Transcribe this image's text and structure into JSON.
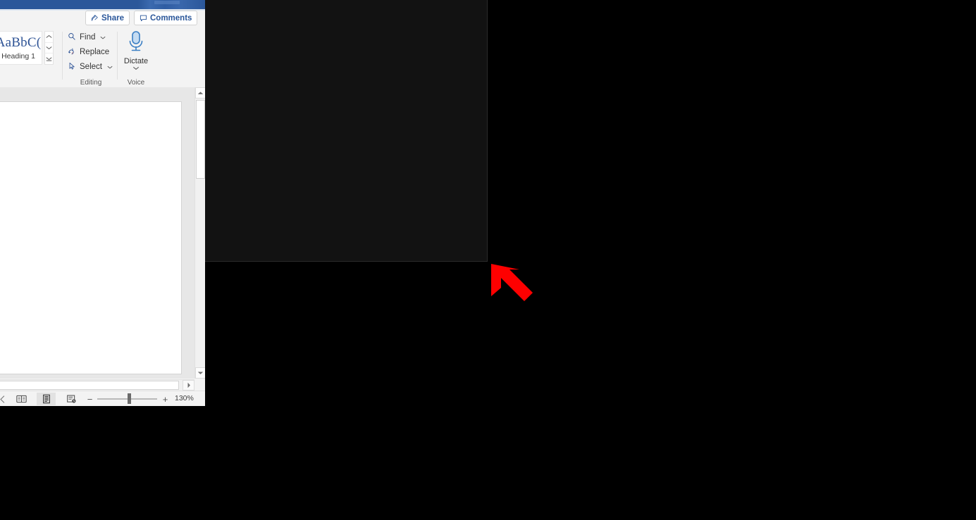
{
  "window": {
    "app": "Microsoft Word",
    "titlebar_color": "#2b579a"
  },
  "ribbon_top": {
    "share_label": "Share",
    "share_icon": "share-person-icon",
    "comments_label": "Comments",
    "comments_icon": "comment-bubble-icon"
  },
  "ribbon": {
    "styles": {
      "group_label": "",
      "preview_text": "AaBbC(",
      "style_name": "Heading 1",
      "scroll_up_icon": "chevron-up-icon",
      "scroll_down_icon": "chevron-down-icon",
      "more_icon": "styles-more-icon",
      "dialog_launcher_icon": "dialog-launcher-icon"
    },
    "editing": {
      "group_label": "Editing",
      "items": [
        {
          "label": "Find",
          "icon": "magnifier-icon",
          "has_caret": true
        },
        {
          "label": "Replace",
          "icon": "replace-bc-icon",
          "has_caret": false
        },
        {
          "label": "Select",
          "icon": "cursor-arrow-icon",
          "has_caret": true
        }
      ]
    },
    "voice": {
      "group_label": "Voice",
      "dictate_label": "Dictate",
      "dictate_icon": "microphone-icon",
      "dictate_caret_icon": "chevron-down-icon"
    },
    "collapse_icon": "chevron-up-icon"
  },
  "document": {
    "page_content": ""
  },
  "scrollbars": {
    "vertical_up_icon": "scroll-up-arrow-icon",
    "vertical_down_icon": "scroll-down-arrow-icon",
    "horizontal_right_icon": "scroll-right-arrow-icon"
  },
  "statusbar": {
    "views": [
      {
        "name": "read-mode",
        "icon": "read-mode-icon",
        "active": false
      },
      {
        "name": "print-layout",
        "icon": "print-layout-icon",
        "active": true
      },
      {
        "name": "web-layout",
        "icon": "web-layout-icon",
        "active": false
      }
    ],
    "zoom_out_label": "−",
    "zoom_in_label": "+",
    "zoom_value": "130%"
  },
  "annotation": {
    "arrow_icon": "red-arrow-up-left",
    "arrow_color": "#fe0000"
  }
}
